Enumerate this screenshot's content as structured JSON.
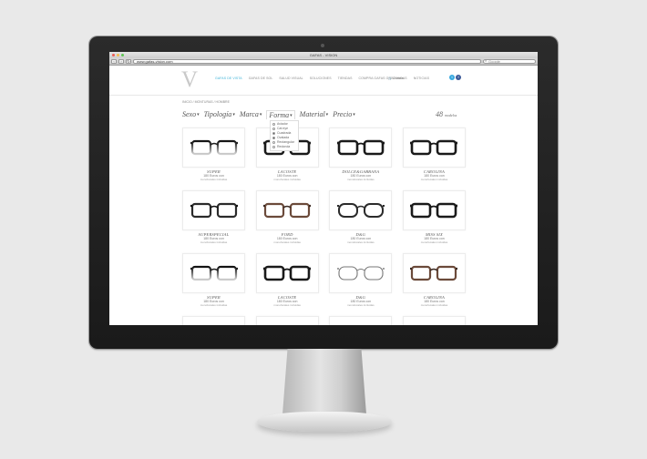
{
  "browser": {
    "window_title": "GAFAS - VISION",
    "url": "www.gafas-vision.com",
    "search_placeholder": "Google"
  },
  "site": {
    "logo": "V",
    "nav": [
      {
        "label": "GAFAS DE VISTA",
        "active": true
      },
      {
        "label": "GAFAS DE SOL",
        "active": false
      },
      {
        "label": "SALUD VISUAL",
        "active": false
      },
      {
        "label": "SOLUCIONES",
        "active": false
      },
      {
        "label": "TIENDAS",
        "active": false
      },
      {
        "label": "COMPRA GAFAS GRADUADAS",
        "active": false
      },
      {
        "label": "NOTICIAS",
        "active": false
      }
    ],
    "cart_label": "0 items",
    "breadcrumb": "INICIO / MONTURAS / HOMBRE",
    "filters": [
      "Sexo",
      "Tipología",
      "Marca",
      "Forma",
      "Material",
      "Precio"
    ],
    "open_filter": "Forma",
    "count": "48",
    "count_label": "modelos",
    "dropdown_options": [
      {
        "label": "Aviador",
        "checked": false
      },
      {
        "label": "Cat eye",
        "checked": false
      },
      {
        "label": "Cuadrada",
        "checked": true
      },
      {
        "label": "Ovalada",
        "checked": true
      },
      {
        "label": "Rectangular",
        "checked": false
      },
      {
        "label": "Redonda",
        "checked": false
      }
    ],
    "colors": {
      "accent": "#3fb3d8",
      "twitter": "#39a9e0",
      "facebook": "#3b5998"
    }
  },
  "products": [
    {
      "brand": "SUPER",
      "price": "180 Euros con",
      "note": "monofocales incluidas",
      "style": "gradient"
    },
    {
      "brand": "LACOSTE",
      "price": "180 Euros con",
      "note": "monofocales incluidas",
      "style": "thick"
    },
    {
      "brand": "DOLCE&GABBANA",
      "price": "180 Euros con",
      "note": "monofocales incluidas",
      "style": "thick"
    },
    {
      "brand": "CAROLINA",
      "price": "180 Euros con",
      "note": "monofocales incluidas",
      "style": "thick"
    },
    {
      "brand": "SUPERSPECIAL",
      "price": "180 Euros con",
      "note": "monofocales incluidas",
      "style": "dark"
    },
    {
      "brand": "FORD",
      "price": "180 Euros con",
      "note": "monofocales incluidas",
      "style": "tort"
    },
    {
      "brand": "D&G",
      "price": "180 Euros con",
      "note": "monofocales incluidas",
      "style": "round"
    },
    {
      "brand": "MISS SIX",
      "price": "180 Euros con",
      "note": "monofocales incluidas",
      "style": "thick"
    },
    {
      "brand": "SUPER",
      "price": "180 Euros con",
      "note": "monofocales incluidas",
      "style": "gradient"
    },
    {
      "brand": "LACOSTE",
      "price": "180 Euros con",
      "note": "monofocales incluidas",
      "style": "thick"
    },
    {
      "brand": "D&G",
      "price": "180 Euros con",
      "note": "monofocales incluidas",
      "style": "thin"
    },
    {
      "brand": "CAROLINA",
      "price": "180 Euros con",
      "note": "monofocales incluidas",
      "style": "tort"
    },
    {
      "brand": "",
      "price": "",
      "note": "",
      "style": "none"
    },
    {
      "brand": "",
      "price": "",
      "note": "",
      "style": "none"
    },
    {
      "brand": "",
      "price": "",
      "note": "",
      "style": "none"
    },
    {
      "brand": "",
      "price": "",
      "note": "",
      "style": "none"
    }
  ]
}
